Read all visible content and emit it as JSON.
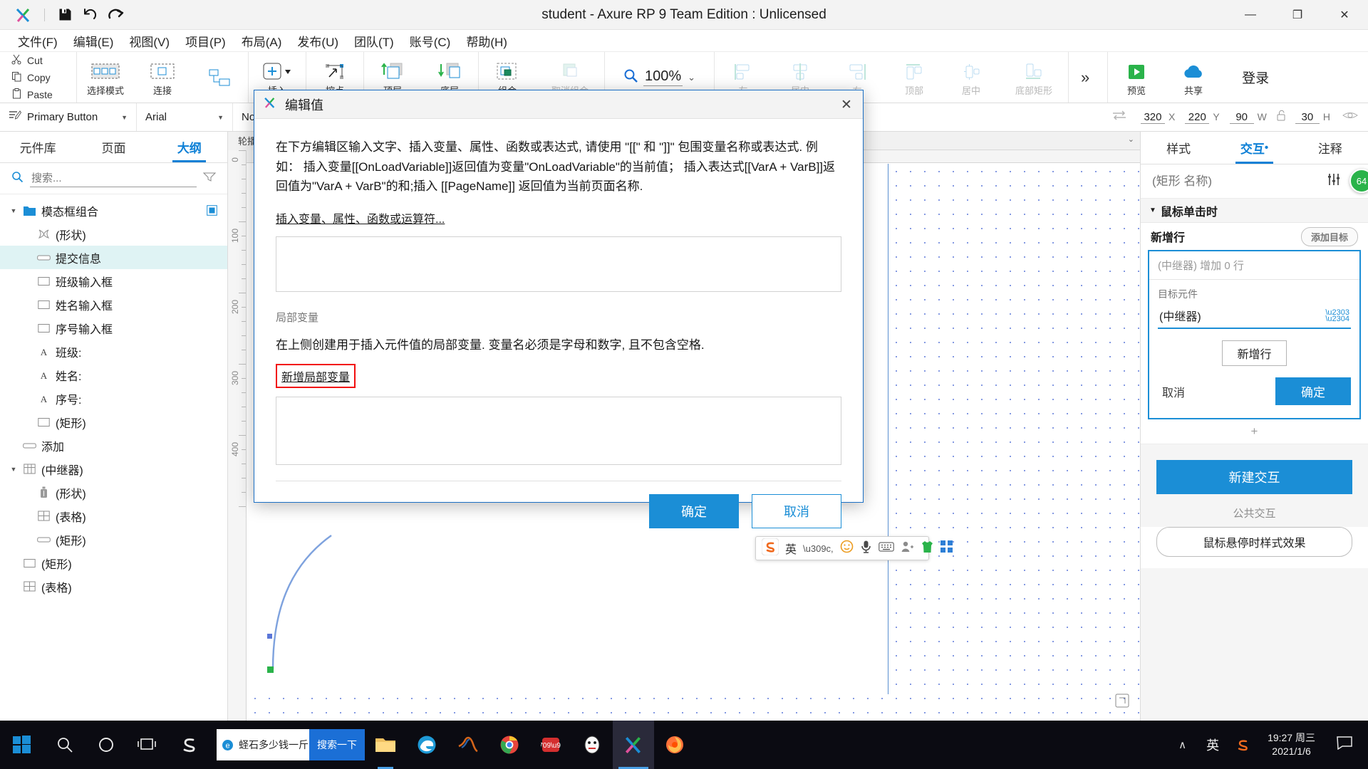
{
  "window": {
    "title": "student - Axure RP 9 Team Edition : Unlicensed",
    "minimize": "—",
    "maximize": "❐",
    "close": "✕"
  },
  "quickbar": {
    "save": "save-icon",
    "undo": "undo-icon",
    "redo": "redo-icon"
  },
  "menubar": {
    "items": [
      {
        "label": "文件(F)"
      },
      {
        "label": "编辑(E)"
      },
      {
        "label": "视图(V)"
      },
      {
        "label": "项目(P)"
      },
      {
        "label": "布局(A)"
      },
      {
        "label": "发布(U)"
      },
      {
        "label": "团队(T)"
      },
      {
        "label": "账号(C)"
      },
      {
        "label": "帮助(H)"
      }
    ]
  },
  "toolbar": {
    "clipboard": [
      {
        "label": "Cut",
        "icon": "scissors-icon"
      },
      {
        "label": "Copy",
        "icon": "copy-icon"
      },
      {
        "label": "Paste",
        "icon": "clipboard-icon"
      }
    ],
    "tools": [
      {
        "label": "选择模式",
        "icon": "select-mode-icon",
        "dim": false
      },
      {
        "label": "连接",
        "icon": "connect-icon",
        "dim": false
      },
      {
        "label": "插入",
        "icon": "insert-plus-icon",
        "dim": false
      },
      {
        "label": "控点",
        "icon": "handle-point-icon",
        "dim": false
      },
      {
        "label": "顶层",
        "icon": "bring-to-front-icon",
        "dim": false
      },
      {
        "label": "底层",
        "icon": "send-to-back-icon",
        "dim": false
      },
      {
        "label": "组合",
        "icon": "group-icon",
        "dim": false
      },
      {
        "label": "取消组合",
        "icon": "ungroup-icon",
        "dim": true
      }
    ],
    "zoom": {
      "value": "100%",
      "icon": "magnifier-icon",
      "caret": "⌄"
    },
    "align_tools": [
      {
        "label": "左",
        "icon": "align-left-icon",
        "dim": true
      },
      {
        "label": "居中",
        "icon": "align-center-icon",
        "dim": true
      },
      {
        "label": "右",
        "icon": "align-right-icon",
        "dim": true
      },
      {
        "label": "顶部",
        "icon": "align-top-icon",
        "dim": true
      },
      {
        "label": "居中",
        "icon": "align-middle-icon",
        "dim": true
      },
      {
        "label": "底部矩形",
        "icon": "align-bottom-icon",
        "dim": true
      }
    ],
    "more": "»",
    "publish": [
      {
        "label": "预览",
        "icon": "preview-play-icon"
      },
      {
        "label": "共享",
        "icon": "share-cloud-icon"
      }
    ],
    "login": "登录"
  },
  "stylebar": {
    "widget_style": "Primary Button",
    "font_family": "Arial",
    "font_weight": "Normal",
    "x": {
      "value": "320",
      "key": "X"
    },
    "y": {
      "value": "220",
      "key": "Y"
    },
    "w": {
      "value": "90",
      "key": "W"
    },
    "h": {
      "value": "30",
      "key": "H"
    },
    "lock_icon": "lock-open-icon",
    "eye_icon": "eye-icon"
  },
  "left_panel": {
    "tabs": [
      {
        "label": "元件库",
        "active": false
      },
      {
        "label": "页面",
        "active": false
      },
      {
        "label": "大纲",
        "active": true
      }
    ],
    "search": {
      "placeholder": "搜索...",
      "value": "",
      "icon": "search-icon",
      "filter_icon": "filter-icon"
    },
    "tree": [
      {
        "label": "模态框组合",
        "depth": 0,
        "arrow": "▼",
        "icon": "folder-icon",
        "selected": false,
        "badge": true
      },
      {
        "label": "(形状)",
        "depth": 1,
        "arrow": "",
        "icon": "shape-x-icon",
        "selected": false
      },
      {
        "label": "提交信息",
        "depth": 1,
        "arrow": "",
        "icon": "button-icon",
        "selected": true
      },
      {
        "label": "班级输入框",
        "depth": 1,
        "arrow": "",
        "icon": "rect-icon",
        "selected": false
      },
      {
        "label": "姓名输入框",
        "depth": 1,
        "arrow": "",
        "icon": "rect-icon",
        "selected": false
      },
      {
        "label": "序号输入框",
        "depth": 1,
        "arrow": "",
        "icon": "rect-icon",
        "selected": false
      },
      {
        "label": "班级:",
        "depth": 1,
        "arrow": "",
        "icon": "text-a-icon",
        "selected": false
      },
      {
        "label": "姓名:",
        "depth": 1,
        "arrow": "",
        "icon": "text-a-icon",
        "selected": false
      },
      {
        "label": "序号:",
        "depth": 1,
        "arrow": "",
        "icon": "text-a-icon",
        "selected": false
      },
      {
        "label": "(矩形)",
        "depth": 1,
        "arrow": "",
        "icon": "rect-icon",
        "selected": false
      },
      {
        "label": "添加",
        "depth": 0,
        "arrow": "",
        "icon": "button-icon",
        "selected": false
      },
      {
        "label": "(中继器)",
        "depth": 0,
        "arrow": "▼",
        "icon": "repeater-icon",
        "selected": false
      },
      {
        "label": "(形状)",
        "depth": 1,
        "arrow": "",
        "icon": "trash-icon",
        "selected": false
      },
      {
        "label": "(表格)",
        "depth": 1,
        "arrow": "",
        "icon": "table-icon",
        "selected": false
      },
      {
        "label": "(矩形)",
        "depth": 1,
        "arrow": "",
        "icon": "button-icon",
        "selected": false
      },
      {
        "label": "(矩形)",
        "depth": 0,
        "arrow": "",
        "icon": "rect-icon",
        "selected": false
      },
      {
        "label": "(表格)",
        "depth": 0,
        "arrow": "",
        "icon": "table-icon",
        "selected": false
      }
    ]
  },
  "canvas": {
    "page_tab": "轮播",
    "tab_caret": "⌄",
    "ruler_v_labels": [
      "0",
      "100",
      "200",
      "300",
      "400"
    ],
    "ime": {
      "logo": "sogou-icon",
      "mode": "英",
      "items": [
        "voice-icon",
        "smiley-icon",
        "mic-icon",
        "keyboard-icon",
        "person-icon",
        "shirt-icon",
        "grid-icon"
      ],
      "comma": "゜゜"
    },
    "corner_icon": "expand-icon"
  },
  "right_panel": {
    "tabs": [
      {
        "label": "样式",
        "active": false
      },
      {
        "label": "交互",
        "active": true,
        "dot": "•"
      },
      {
        "label": "注释",
        "active": false
      }
    ],
    "name_placeholder": "(矩形 名称)",
    "name_value": "",
    "sliders_icon": "sliders-icon",
    "badge": "64",
    "event_header": {
      "label": "鼠标单击时",
      "arrow": "▼"
    },
    "action": {
      "label": "新增行",
      "add_target": "添加目标"
    },
    "editor": {
      "summary": "(中继器) 增加 0 行",
      "target_label": "目标元件",
      "target_value": "(中继器)",
      "spinner": "spinner-icon",
      "add_row_button": "新增行",
      "cancel": "取消",
      "confirm": "确定"
    },
    "plus_row": "+",
    "new_interaction": "新建交互",
    "public_interactions_label": "公共交互",
    "hover_style_button": "鼠标悬停时样式效果"
  },
  "modal": {
    "title": "编辑值",
    "logo": "axure-logo-icon",
    "close": "✕",
    "description": "在下方编辑区输入文字、插入变量、属性、函数或表达式, 请使用 \"[[\" 和 \"]]\" 包围变量名称或表达式. 例如： 插入变量[[OnLoadVariable]]返回值为变量\"OnLoadVariable\"的当前值； 插入表达式[[VarA + VarB]]返回值为\"VarA + VarB\"的和;插入 [[PageName]] 返回值为当前页面名称.",
    "insert_link": "插入变量、属性、函数或运算符...",
    "editor_value": "",
    "local_var_label": "局部变量",
    "local_var_desc": "在上侧创建用于插入元件值的局部变量. 变量名必须是字母和数字, 且不包含空格.",
    "add_local_var": "新增局部变量",
    "highlight_color": "#f20d0d",
    "ok": "确定",
    "cancel": "取消"
  },
  "taskbar": {
    "start": "start-icon",
    "search": "search-icon",
    "cortana": "cortana-icon",
    "taskview": "task-view-icon",
    "browser_search": {
      "query": "蛏石多少钱一斤",
      "go": "搜索一下",
      "icon": "edge-e-icon"
    },
    "apps": [
      {
        "icon": "sogou-s-icon",
        "name": "sogou-input",
        "state": ""
      },
      {
        "icon": "explorer-icon",
        "name": "file-explorer",
        "state": "running"
      },
      {
        "icon": "edge-icon",
        "name": "edge-browser",
        "state": ""
      },
      {
        "icon": "matlab-icon",
        "name": "matlab",
        "state": ""
      },
      {
        "icon": "chrome-icon",
        "name": "chrome",
        "state": ""
      },
      {
        "icon": "youdao-icon",
        "name": "youdao-dictionary",
        "state": ""
      },
      {
        "icon": "qq-icon",
        "name": "qq",
        "state": ""
      },
      {
        "icon": "axure-icon",
        "name": "axure-rp",
        "state": "active"
      },
      {
        "icon": "firefox-icon",
        "name": "firefox",
        "state": ""
      }
    ],
    "tray": {
      "chevron": "∧",
      "ime": "英",
      "sogou": "sogou-tray-icon",
      "time": "19:27 周三",
      "date": "2021/1/6",
      "notification": "notification-icon"
    }
  },
  "colors": {
    "accent": "#1b8ed6",
    "selection": "#dff3f4",
    "highlight_red": "#f20d0d",
    "green_badge": "#2ab34a"
  }
}
